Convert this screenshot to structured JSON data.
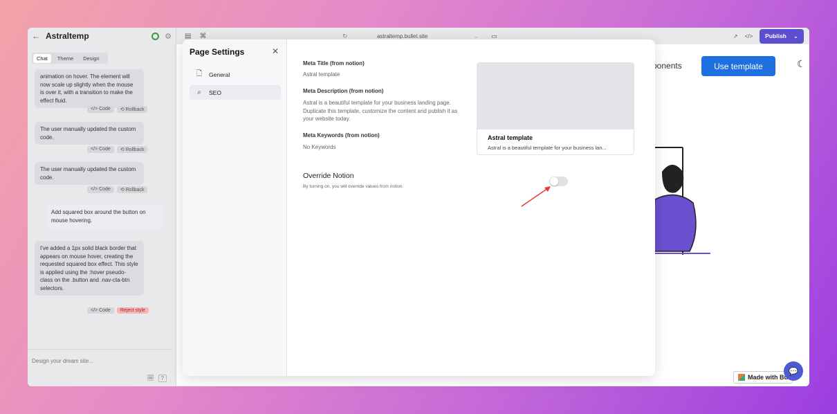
{
  "app": {
    "back_icon": "back-arrow-icon",
    "project_name": "Astraltemp",
    "url": "astraltemp.bullet.site",
    "publish_label": "Publish"
  },
  "chat": {
    "tabs": [
      "Chat",
      "Theme",
      "Design"
    ],
    "active_tab": "Chat",
    "messages": [
      {
        "text": "animation on hover. The element will now scale up slightly when the mouse is over it, with a transition to make the effect fluid.",
        "code": "</> Code",
        "action": "⟲ Rollback"
      },
      {
        "text": "The user manually updated the custom code.",
        "code": "</> Code",
        "action": "⟲ Rollback"
      },
      {
        "text": "The user manually updated the custom code.",
        "code": "</> Code",
        "action": "⟲ Rollback"
      },
      {
        "text": "I've added a 1px solid black border that appears on mouse hover, creating the requested squared box effect. This style is applied using the :hover pseudo-class on the .button and .nav-cta-btn selectors.",
        "code": "</> Code",
        "action": "Reject style"
      }
    ],
    "user_message": "Add squared box around the button on mouse hovering.",
    "input_placeholder": "Design your dream site...",
    "help_label": "?"
  },
  "preview": {
    "nav_partial": "ponents",
    "cta_label": "Use template",
    "made_with": "Made with Bu"
  },
  "modal": {
    "title": "Page Settings",
    "close_icon": "close-icon",
    "nav": [
      {
        "label": "General",
        "icon": "document-icon"
      },
      {
        "label": "SEO",
        "icon": "search-icon"
      }
    ],
    "active_nav": "SEO",
    "fields": {
      "meta_title_label": "Meta Title (from notion)",
      "meta_title_value": "Astral template",
      "meta_desc_label": "Meta Description (from notion)",
      "meta_desc_value": "Astral is a beautiful template for your business landing page. Duplicate this template, customize the content and publish it as your website today.",
      "meta_keywords_label": "Meta Keywords (from notion)",
      "meta_keywords_value": "No Keywords"
    },
    "preview_card": {
      "title": "Astral template",
      "description": "Astral is a beautiful template for your business lan..."
    },
    "override": {
      "title": "Override Notion",
      "description": "By turning on, you will override values from notion.",
      "enabled": false
    }
  },
  "colors": {
    "publish": "#5b4fcf",
    "cta": "#1e6fe0",
    "status": "#2e9e3e",
    "annotation_arrow": "#e53935"
  }
}
